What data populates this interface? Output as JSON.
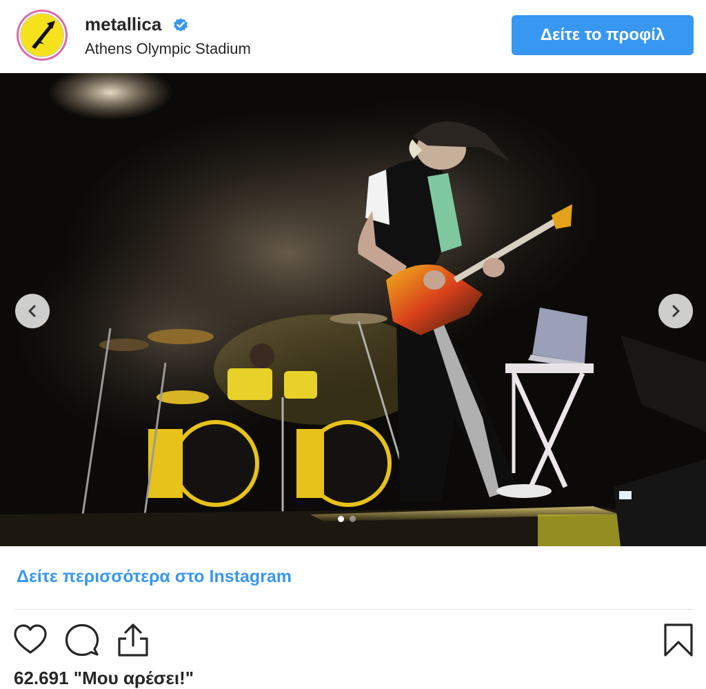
{
  "post": {
    "username": "metallica",
    "location": "Athens Olympic Stadium",
    "profile_button": "Δείτε το προφίλ",
    "more_link": "Δείτε περισσότερα στο Instagram",
    "likes": "62.691 \"Μου αρέσει!\""
  },
  "carousel": {
    "total": 2,
    "active": 0
  },
  "colors": {
    "accent": "#3897f0",
    "avatar_bg": "#f5e21d",
    "text": "#262626",
    "divider": "#dbdbdb"
  },
  "icons": {
    "verified": "verified-badge-icon",
    "prev": "chevron-left-icon",
    "next": "chevron-right-icon",
    "like": "heart-icon",
    "comment": "comment-icon",
    "share": "share-icon",
    "save": "bookmark-icon"
  }
}
